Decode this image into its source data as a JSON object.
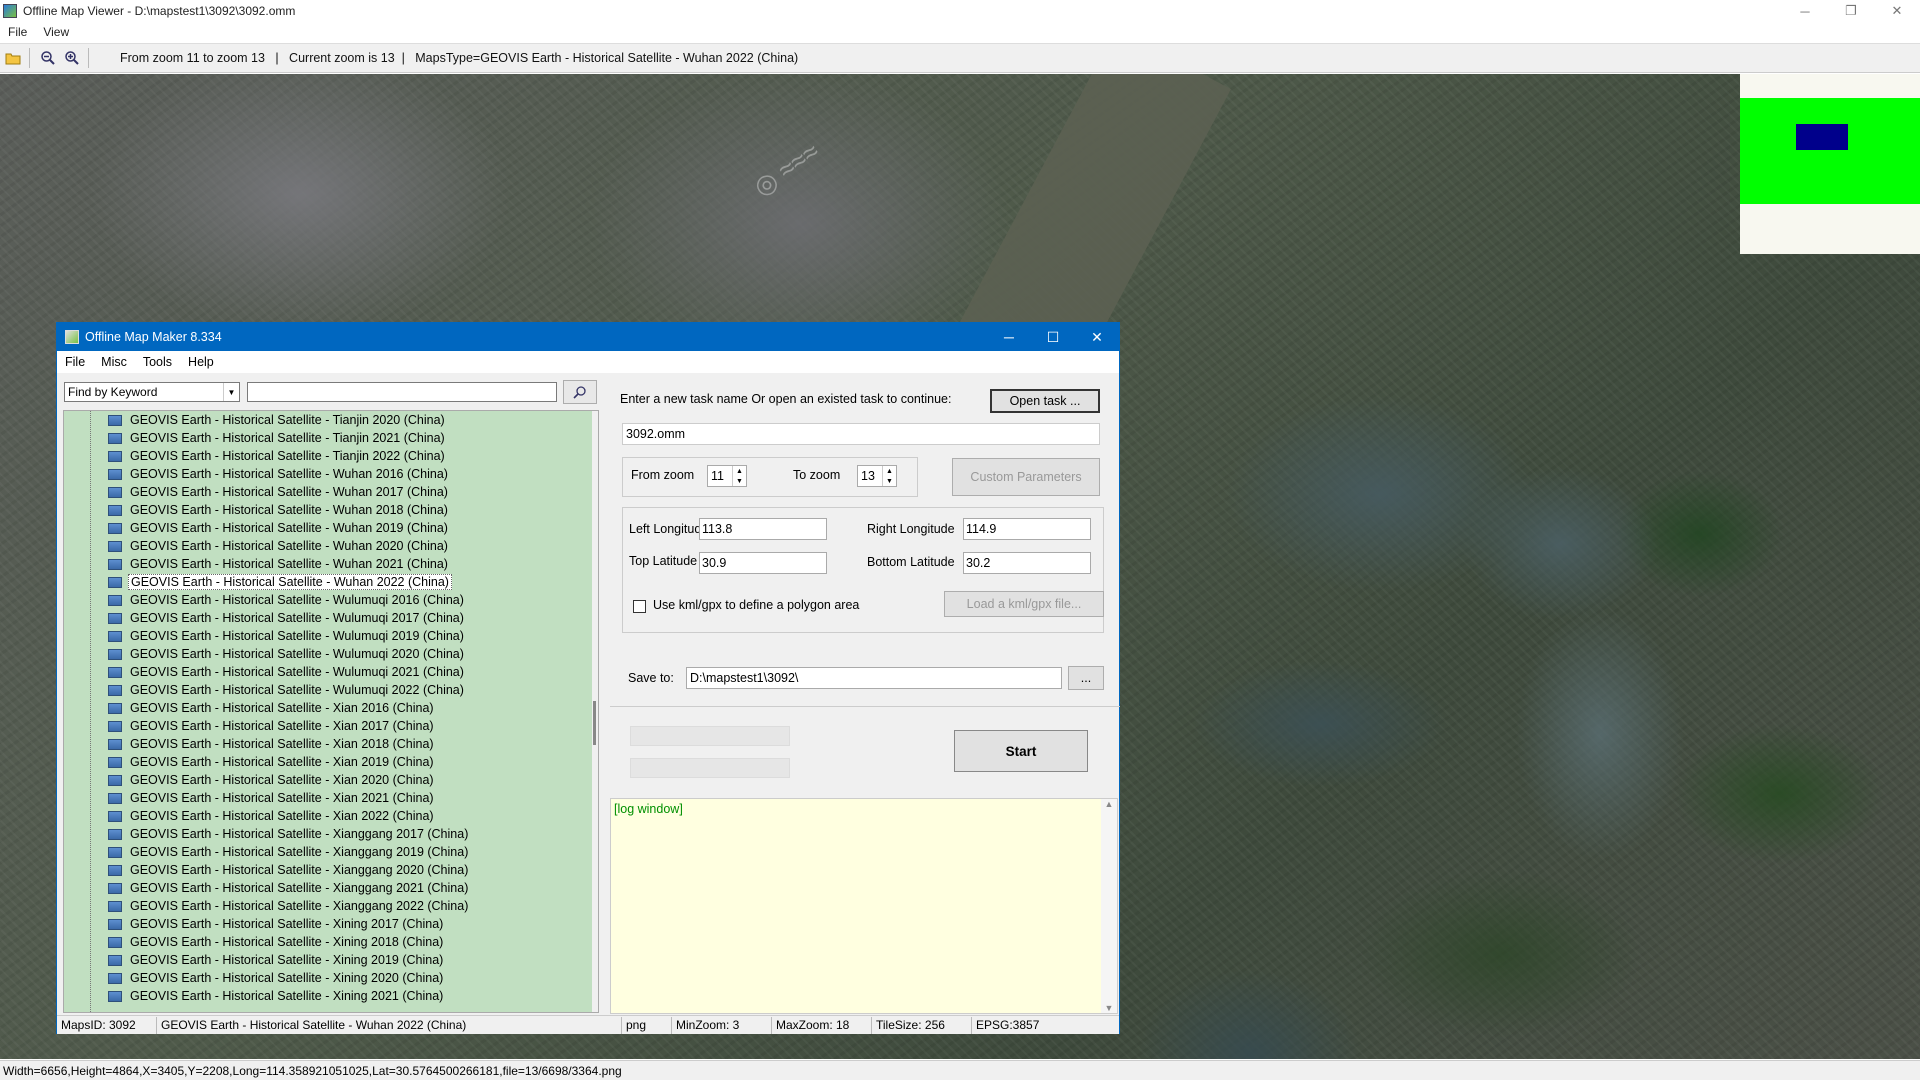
{
  "outer": {
    "title": "Offline Map Viewer - D:\\mapstest1\\3092\\3092.omm",
    "controls": {
      "minimize": "─",
      "restore": "❐",
      "close": "✕"
    },
    "menu": [
      "File",
      "View"
    ],
    "toolbar_info": "From zoom 11 to zoom 13   |   Current zoom is 13  |   MapsType=GEOVIS Earth - Historical Satellite - Wuhan 2022 (China)",
    "status": "Width=6656,Height=4864,X=3405,Y=2208,Long=114.358921051025,Lat=30.5764500266181,file=13/6698/3364.png"
  },
  "dialog": {
    "title": "Offline Map Maker 8.334",
    "controls": {
      "minimize": "─",
      "maximize": "☐",
      "close": "✕"
    },
    "menu": [
      "File",
      "Misc",
      "Tools",
      "Help"
    ],
    "find_mode": "Find by Keyword",
    "tree_items": [
      "GEOVIS Earth - Historical Satellite - Tianjin 2020 (China)",
      "GEOVIS Earth - Historical Satellite - Tianjin 2021 (China)",
      "GEOVIS Earth - Historical Satellite - Tianjin 2022 (China)",
      "GEOVIS Earth - Historical Satellite - Wuhan 2016 (China)",
      "GEOVIS Earth - Historical Satellite - Wuhan 2017 (China)",
      "GEOVIS Earth - Historical Satellite - Wuhan 2018 (China)",
      "GEOVIS Earth - Historical Satellite - Wuhan 2019 (China)",
      "GEOVIS Earth - Historical Satellite - Wuhan 2020 (China)",
      "GEOVIS Earth - Historical Satellite - Wuhan 2021 (China)",
      "GEOVIS Earth - Historical Satellite - Wuhan 2022 (China)",
      "GEOVIS Earth - Historical Satellite - Wulumuqi 2016 (China)",
      "GEOVIS Earth - Historical Satellite - Wulumuqi 2017 (China)",
      "GEOVIS Earth - Historical Satellite - Wulumuqi 2019 (China)",
      "GEOVIS Earth - Historical Satellite - Wulumuqi 2020 (China)",
      "GEOVIS Earth - Historical Satellite - Wulumuqi 2021 (China)",
      "GEOVIS Earth - Historical Satellite - Wulumuqi 2022 (China)",
      "GEOVIS Earth - Historical Satellite - Xian 2016 (China)",
      "GEOVIS Earth - Historical Satellite - Xian 2017 (China)",
      "GEOVIS Earth - Historical Satellite - Xian 2018 (China)",
      "GEOVIS Earth - Historical Satellite - Xian 2019 (China)",
      "GEOVIS Earth - Historical Satellite - Xian 2020 (China)",
      "GEOVIS Earth - Historical Satellite - Xian 2021 (China)",
      "GEOVIS Earth - Historical Satellite - Xian 2022 (China)",
      "GEOVIS Earth - Historical Satellite - Xianggang 2017 (China)",
      "GEOVIS Earth - Historical Satellite - Xianggang 2019 (China)",
      "GEOVIS Earth - Historical Satellite - Xianggang 2020 (China)",
      "GEOVIS Earth - Historical Satellite - Xianggang 2021 (China)",
      "GEOVIS Earth - Historical Satellite - Xianggang 2022 (China)",
      "GEOVIS Earth - Historical Satellite - Xining 2017 (China)",
      "GEOVIS Earth - Historical Satellite - Xining 2018 (China)",
      "GEOVIS Earth - Historical Satellite - Xining 2019 (China)",
      "GEOVIS Earth - Historical Satellite - Xining 2020 (China)",
      "GEOVIS Earth - Historical Satellite - Xining 2021 (China)"
    ],
    "selected_item": "GEOVIS Earth - Historical Satellite - Wuhan 2022 (China)",
    "task_prompt": "Enter a new task name Or open an existed task to continue:",
    "open_task_label": "Open task ...",
    "task_name": "3092.omm",
    "from_zoom_label": "From zoom",
    "from_zoom": "11",
    "to_zoom_label": "To zoom",
    "to_zoom": "13",
    "custom_params_label": "Custom Parameters",
    "left_lon_label": "Left Longitude",
    "left_lon": "113.8",
    "right_lon_label": "Right Longitude",
    "right_lon": "114.9",
    "top_lat_label": "Top Latitude",
    "top_lat": "30.9",
    "bottom_lat_label": "Bottom Latitude",
    "bottom_lat": "30.2",
    "kml_checkbox_label": "Use kml/gpx to define a polygon area",
    "load_kml_label": "Load a kml/gpx file...",
    "save_to_label": "Save to:",
    "save_path": "D:\\mapstest1\\3092\\",
    "browse_label": "...",
    "start_label": "Start",
    "log_text": "[log window]",
    "status": {
      "maps_id": "MapsID: 3092",
      "maps_name": "GEOVIS Earth - Historical Satellite - Wuhan 2022 (China)",
      "format": "png",
      "min_zoom": "MinZoom: 3",
      "max_zoom": "MaxZoom: 18",
      "tile_size": "TileSize: 256",
      "epsg": "EPSG:3857"
    }
  },
  "colors": {
    "dialog_title_bar": "#0067c0",
    "tree_bg": "#c1dfc1",
    "log_bg": "#ffffe0",
    "log_text": "#009000",
    "overview_bg": "#00ff00",
    "overview_box": "#00008b"
  }
}
